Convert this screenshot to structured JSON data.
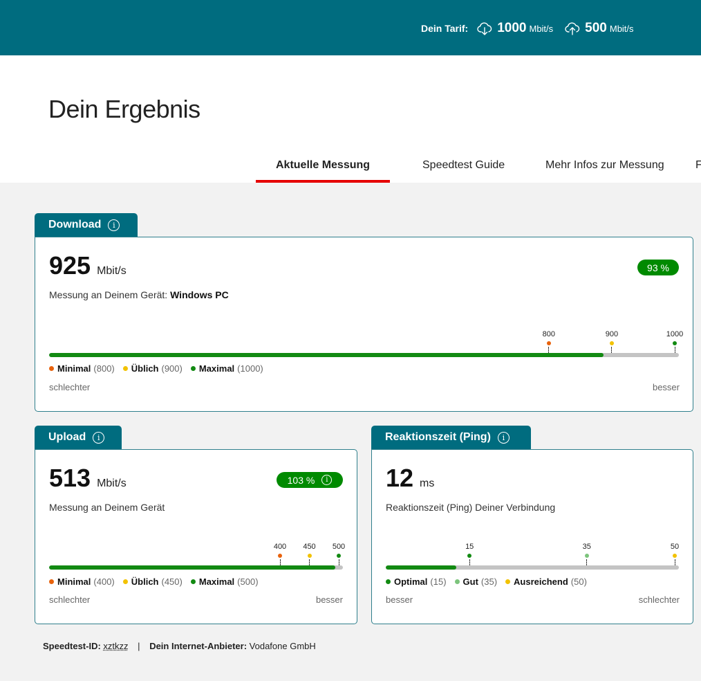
{
  "header": {
    "tarif_label": "Dein Tarif:",
    "download_rate": "1000",
    "download_unit": "Mbit/s",
    "upload_rate": "500",
    "upload_unit": "Mbit/s",
    "download_icon": "cloud-download-icon",
    "upload_icon": "cloud-upload-icon"
  },
  "page": {
    "title": "Dein Ergebnis"
  },
  "tabs": [
    {
      "label": "Aktuelle Messung",
      "active": true
    },
    {
      "label": "Speedtest Guide",
      "active": false
    },
    {
      "label": "Mehr Infos zur Messung",
      "active": false
    },
    {
      "label": "F",
      "active": false
    }
  ],
  "download": {
    "title": "Download",
    "value": "925",
    "unit": "Mbit/s",
    "percent": "93 %",
    "device_label": "Messung an Deinem Gerät:",
    "device": "Windows PC",
    "scale_max": 1000,
    "fill_value": 880,
    "markers": [
      {
        "label": "800",
        "value": 800,
        "color": "#e8620c"
      },
      {
        "label": "900",
        "value": 900,
        "color": "#f2c200"
      },
      {
        "label": "1000",
        "value": 1000,
        "color": "#128a12"
      }
    ],
    "legend": [
      {
        "label": "Minimal",
        "value": "(800)",
        "color": "#e8620c"
      },
      {
        "label": "Üblich",
        "value": "(900)",
        "color": "#f2c200"
      },
      {
        "label": "Maximal",
        "value": "(1000)",
        "color": "#128a12"
      }
    ],
    "scale_left": "schlechter",
    "scale_right": "besser"
  },
  "upload": {
    "title": "Upload",
    "value": "513",
    "unit": "Mbit/s",
    "percent": "103 %",
    "device_label": "Messung an Deinem Gerät",
    "scale_max": 500,
    "fill_value": 487,
    "markers": [
      {
        "label": "400",
        "value": 400,
        "color": "#e8620c"
      },
      {
        "label": "450",
        "value": 450,
        "color": "#f2c200"
      },
      {
        "label": "500",
        "value": 500,
        "color": "#128a12"
      }
    ],
    "legend": [
      {
        "label": "Minimal",
        "value": "(400)",
        "color": "#e8620c"
      },
      {
        "label": "Üblich",
        "value": "(450)",
        "color": "#f2c200"
      },
      {
        "label": "Maximal",
        "value": "(500)",
        "color": "#128a12"
      }
    ],
    "scale_left": "schlechter",
    "scale_right": "besser"
  },
  "ping": {
    "title": "Reaktionszeit (Ping)",
    "value": "12",
    "unit": "ms",
    "description": "Reaktionszeit (Ping) Deiner Verbindung",
    "scale_max": 50,
    "fill_value": 12,
    "markers": [
      {
        "label": "15",
        "value": 15,
        "color": "#128a12"
      },
      {
        "label": "35",
        "value": 35,
        "color": "#7cc47c"
      },
      {
        "label": "50",
        "value": 50,
        "color": "#f2c200"
      }
    ],
    "legend": [
      {
        "label": "Optimal",
        "value": "(15)",
        "color": "#128a12"
      },
      {
        "label": "Gut",
        "value": "(35)",
        "color": "#7cc47c"
      },
      {
        "label": "Ausreichend",
        "value": "(50)",
        "color": "#f2c200"
      }
    ],
    "scale_left": "besser",
    "scale_right": "schlechter"
  },
  "footer": {
    "id_label": "Speedtest-ID:",
    "id_value": "xztkzz",
    "separator": "|",
    "provider_label": "Dein Internet-Anbieter:",
    "provider_value": "Vodafone GmbH"
  }
}
